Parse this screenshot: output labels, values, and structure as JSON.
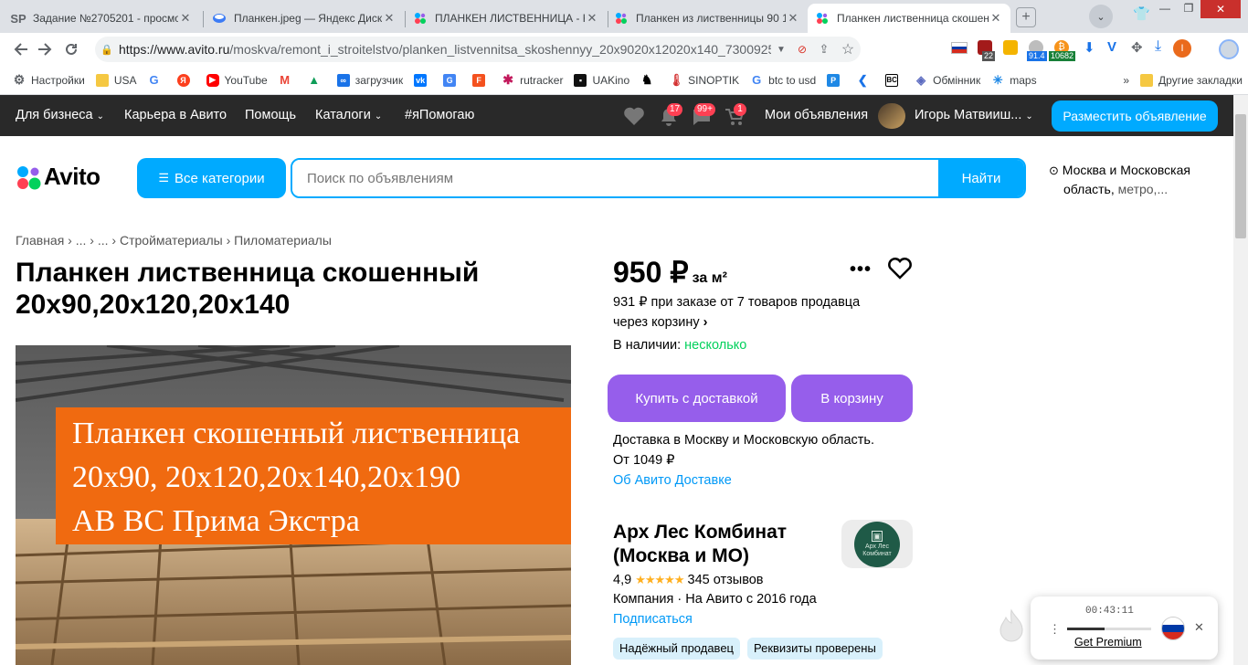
{
  "browser": {
    "tabs": [
      {
        "label": "Задание №2705201 - просмотр",
        "favicon": "SP"
      },
      {
        "label": "Планкен.jpeg — Яндекс Диск",
        "favicon": "yadisk-icon"
      },
      {
        "label": "ПЛАНКЕН ЛИСТВЕННИЦА - К",
        "favicon": "avito-icon"
      },
      {
        "label": "Планкен из лиственницы 90 1",
        "favicon": "avito-icon"
      },
      {
        "label": "Планкен лиственница скошен",
        "favicon": "avito-icon"
      }
    ],
    "address": {
      "host": "https://www.avito.ru",
      "path": "/moskva/remont_i_stroitelstvo/planken_listvennitsa_skoshennyy_20x9020x12020x140_7300925030?slocati..."
    },
    "extension_badges": {
      "ext_1": "22",
      "ext_2": "91.4",
      "ext_3": "10682"
    },
    "profile_initial": "I",
    "bookmarks": [
      {
        "label": "Настройки"
      },
      {
        "label": "USA"
      },
      {
        "label": ""
      },
      {
        "label": ""
      },
      {
        "label": "YouTube"
      },
      {
        "label": ""
      },
      {
        "label": ""
      },
      {
        "label": "загрузчик"
      },
      {
        "label": ""
      },
      {
        "label": ""
      },
      {
        "label": ""
      },
      {
        "label": "rutracker"
      },
      {
        "label": "UAKino"
      },
      {
        "label": ""
      },
      {
        "label": "SINOPTIK"
      },
      {
        "label": "btc to usd"
      },
      {
        "label": ""
      },
      {
        "label": ""
      },
      {
        "label": ""
      },
      {
        "label": "Обмінник"
      },
      {
        "label": "maps"
      }
    ],
    "overflow": "»",
    "other_bookmarks": "Другие закладки"
  },
  "avito": {
    "topbar": {
      "business": "Для бизнеса",
      "career": "Карьера в Авито",
      "help": "Помощь",
      "catalogs": "Каталоги",
      "help_tag": "#яПомогаю",
      "badges": {
        "notifications": "17",
        "messages": "99+",
        "cart": "1"
      },
      "my_ads": "Мои объявления",
      "user": "Игорь Матвииш...",
      "post_ad": "Разместить объявление"
    },
    "logo": "Avito",
    "categories_btn": "Все категории",
    "search": {
      "placeholder": "Поиск по объявлениям",
      "button": "Найти"
    },
    "location": {
      "line1": "Москва и Московская",
      "line2": "область,",
      "line2_more": "метро,..."
    },
    "breadcrumbs": {
      "home": "Главная",
      "e1": "...",
      "e2": "...",
      "c1": "Стройматериалы",
      "c2": "Пиломатериалы"
    },
    "title": "Планкен лиственница скошенный 20х90,20х120,20х140",
    "photo_text": [
      "Планкен скошенный лиственница",
      "20х90, 20х120,20х140,20х190",
      "АВ ВС Прима Экстра"
    ],
    "price": {
      "value": "950 ₽",
      "unit": "за м²"
    },
    "bulk": {
      "line1": "931 ₽ при заказе от 7 товаров продавца",
      "line2": "через корзину"
    },
    "stock": {
      "label": "В наличии:",
      "value": "несколько"
    },
    "buy_delivery": "Купить с доставкой",
    "to_cart": "В корзину",
    "delivery": {
      "line1": "Доставка в Москву и Московскую область.",
      "line2": "От 1049 ₽",
      "link": "Об Авито Доставке"
    },
    "seller": {
      "name": "Арх Лес Комбинат (Москва и МО)",
      "rating": "4,9",
      "stars": 5,
      "reviews": "345 отзывов",
      "type": "Компания · На Авито с 2016 года",
      "subscribe": "Подписаться",
      "chips": [
        "Надёжный продавец",
        "Реквизиты проверены"
      ],
      "logo_text": "Арх Лес Комбинат"
    }
  },
  "player": {
    "time": "00:43:11",
    "progress_pct": 45,
    "cta": "Get Premium"
  },
  "colors": {
    "avito_blue": "#00aaff",
    "avito_purple": "#965eeb",
    "topbar": "#292929",
    "green": "#02d15c",
    "link": "#0099f7"
  }
}
